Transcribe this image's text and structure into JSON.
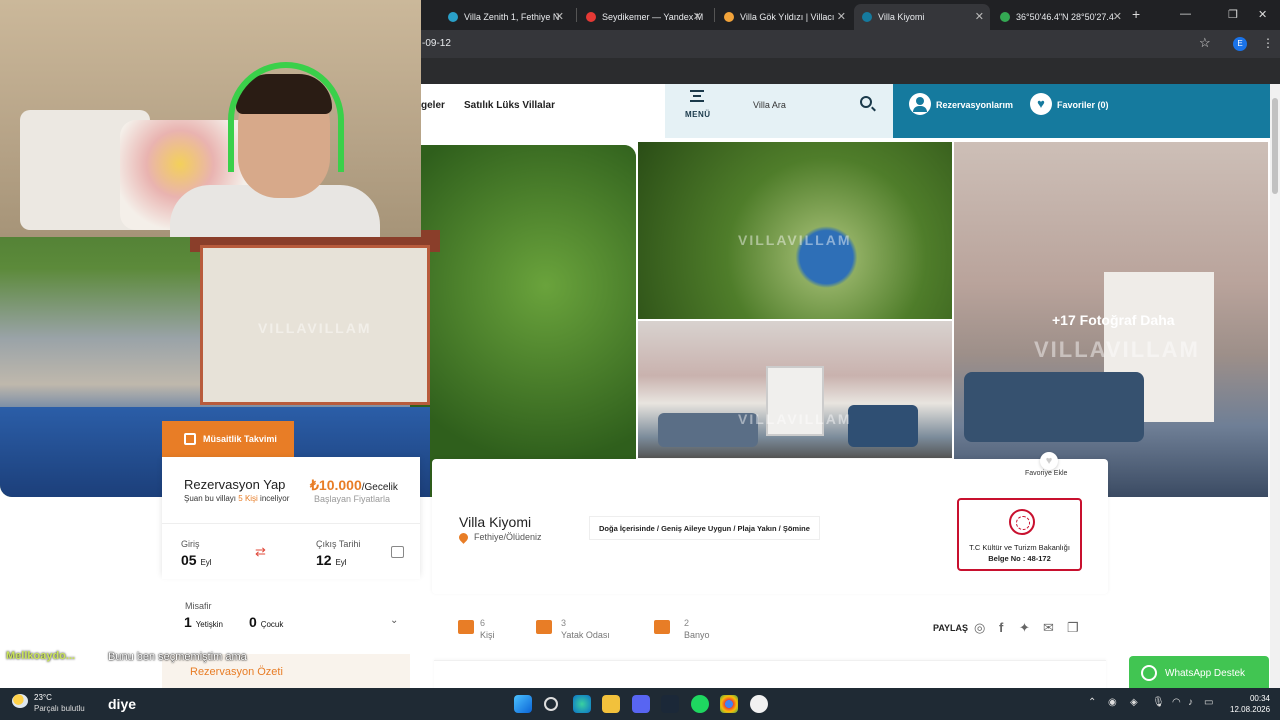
{
  "browser": {
    "tabs": [
      {
        "label": "Villa Zenith 1, Fethiye N"
      },
      {
        "label": "Seydikemer — Yandex M"
      },
      {
        "label": "Villa Gök Yıldızı | Villacı"
      },
      {
        "label": "Villa Kiyomi"
      },
      {
        "label": "36°50'46.4\"N 28°50'27.4"
      }
    ],
    "new_tab": "+",
    "url_fragment": "-09-12",
    "profile_initial": "E"
  },
  "header": {
    "nav_partial": "geler",
    "nav_item": "Satılık Lüks Villalar",
    "menu_label": "MENÜ",
    "search_label": "Villa Ara",
    "reservations_label": "Rezervasyonlarım",
    "favorites_label": "Favoriler (0)"
  },
  "gallery": {
    "watermark": "VILLAVILLAM",
    "more_photos": "+17 Fotoğraf Daha"
  },
  "booking": {
    "calendar_tab": "Müsaitlik Takvimi",
    "title": "Rezervasyon Yap",
    "viewers_prefix": "Şuan bu villayı ",
    "viewers_count": "5 Kişi",
    "viewers_suffix": " inceliyor",
    "price": "₺10.000",
    "price_unit": "/Gecelik",
    "price_note": "Başlayan Fiyatlarla",
    "checkin_label": "Giriş",
    "checkin_day": "05",
    "checkin_month": "Eyl",
    "checkout_label": "Çıkış Tarihi",
    "checkout_day": "12",
    "checkout_month": "Eyl",
    "guests_label": "Misafir",
    "adults": "1",
    "adults_label": "Yetişkin",
    "children": "0",
    "children_label": "Çocuk",
    "summary_label": "Rezervasyon Özeti"
  },
  "villa": {
    "name": "Villa Kiyomi",
    "location": "Fethiye/Ölüdeniz",
    "tags": "Doğa İçerisinde / Geniş Aileye Uygun / Plaja Yakın / Şömine",
    "favorite_label": "Favoriye Ekle",
    "license_line1": "T.C Kültür ve Turizm Bakanlığı",
    "license_line2": "Belge No : 48-172",
    "features": [
      {
        "value": "6",
        "label": "Kişi",
        "icon": "people-icon"
      },
      {
        "value": "3",
        "label": "Yatak Odası",
        "icon": "bed-icon"
      },
      {
        "value": "2",
        "label": "Banyo",
        "icon": "bath-icon"
      }
    ],
    "share_label": "PAYLAŞ",
    "whatsapp_label": "WhatsApp Destek"
  },
  "chat": {
    "user": "Mellkoaydo...",
    "message": "Bunu ben seçmemiştim ama"
  },
  "taskbar": {
    "temperature": "23°C",
    "condition": "Parçalı bulutlu",
    "typed_text": "diye",
    "time": "00:34",
    "date": "12.08.2026"
  },
  "colors": {
    "accent": "#e87d26",
    "brand_blue": "#157a9e",
    "whatsapp": "#41c552",
    "license_red": "#c8102e"
  }
}
